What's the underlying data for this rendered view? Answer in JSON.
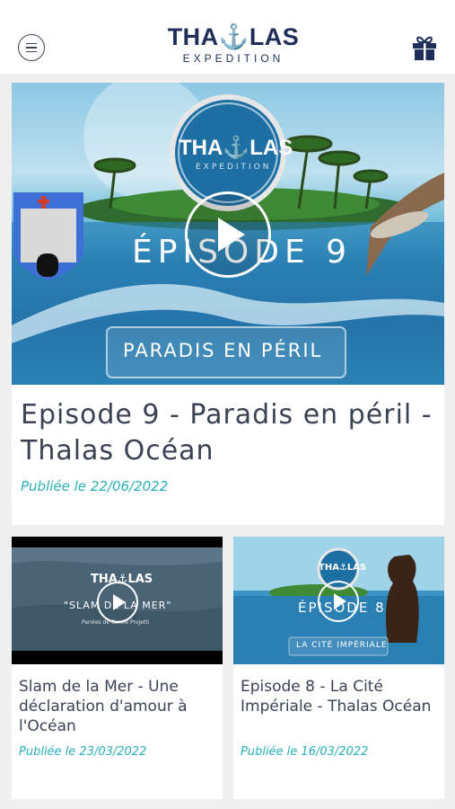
{
  "header": {
    "logo_top_left": "THA",
    "logo_anchor": "⚓",
    "logo_top_right": "LAS",
    "logo_bottom": "EXPEDITION",
    "menu_icon": "hamburger-menu-icon",
    "gift_icon": "gift-icon"
  },
  "featured": {
    "thumb": {
      "logo": "THA⚓LAS",
      "logo_sub": "EXPEDITION",
      "episode": "ÉPISODE 9",
      "banner": "PARADIS EN PÉRIL"
    },
    "title": "Episode 9 - Paradis en péril - Thalas Océan",
    "date": "Publiée le 22/06/2022"
  },
  "cards": [
    {
      "thumb": {
        "logo": "THA⚓LAS",
        "caption": "\"SLAM DE LA MER\"",
        "sub": "Paroles de Carole Projetti"
      },
      "title": "Slam de la Mer - Une déclaration d'amour à l'Océan",
      "date": "Publiée le 23/03/2022"
    },
    {
      "thumb": {
        "logo": "THA⚓LAS",
        "episode": "ÉPISODE 8",
        "banner": "LA CITÉ IMPÉRIALE"
      },
      "title": "Episode 8 - La Cité Impériale - Thalas Océan",
      "date": "Publiée le 16/03/2022"
    }
  ],
  "colors": {
    "brand_navy": "#1f2f5a",
    "brand_red": "#e1483a",
    "date_teal": "#29b0b8"
  }
}
